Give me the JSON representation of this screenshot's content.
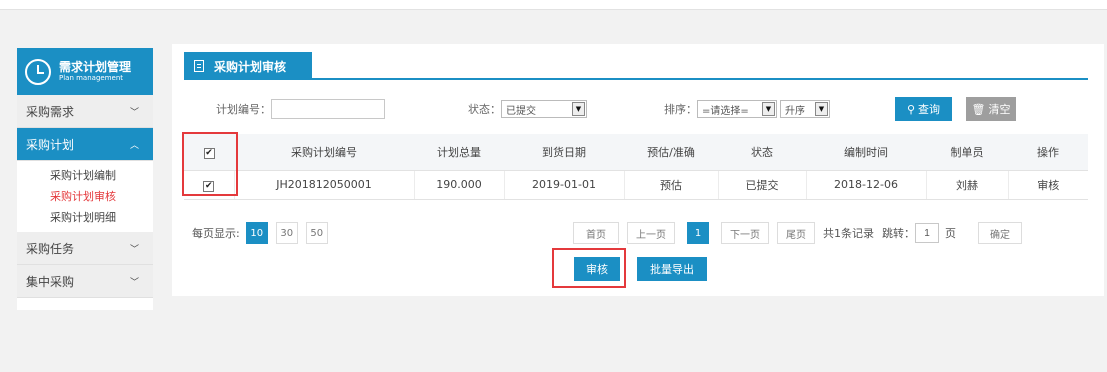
{
  "sidebar": {
    "title": "需求计划管理",
    "subtitle": "Plan management",
    "groups": [
      {
        "label": "采购需求",
        "chevron": "﹀"
      },
      {
        "label": "采购计划",
        "chevron": "︿"
      },
      {
        "label": "采购任务",
        "chevron": "﹀"
      },
      {
        "label": "集中采购",
        "chevron": "﹀"
      }
    ],
    "subitems": [
      "采购计划编制",
      "采购计划审核",
      "采购计划明细"
    ]
  },
  "panel": {
    "title": "采购计划审核"
  },
  "filters": {
    "plan_no_label": "计划编号：",
    "plan_no_value": "",
    "status_label": "状态：",
    "status_value": "已提交",
    "sort_label": "排序：",
    "sort_value": "=请选择=",
    "order_value": "升序",
    "query_label": "查询",
    "clear_label": "清空"
  },
  "table": {
    "headers": [
      "采购计划编号",
      "计划总量",
      "到货日期",
      "预估/准确",
      "状态",
      "编制时间",
      "制单员",
      "操作"
    ],
    "rows": [
      {
        "plan_no": "JH201812050001",
        "total": "190.000",
        "arrival": "2019-01-01",
        "estimate": "预估",
        "status": "已提交",
        "created": "2018-12-06",
        "creator": "刘赫",
        "action": "审核"
      }
    ]
  },
  "pager": {
    "per_page_label": "每页显示:",
    "sizes": [
      "10",
      "30",
      "50"
    ],
    "first": "首页",
    "prev": "上一页",
    "current": "1",
    "next": "下一页",
    "last": "尾页",
    "summary": "共1条记录",
    "jump_label": "跳转：",
    "jump_value": "1",
    "page_unit": "页",
    "confirm": "确定"
  },
  "actions": {
    "audit": "审核",
    "export": "批量导出"
  },
  "colors": {
    "accent": "#1b8fc4",
    "highlight": "#e4393c"
  },
  "icons": [
    "clock-icon",
    "document-icon",
    "search-icon",
    "trash-icon",
    "chevron-down-icon",
    "chevron-up-icon",
    "checkbox-icon"
  ]
}
